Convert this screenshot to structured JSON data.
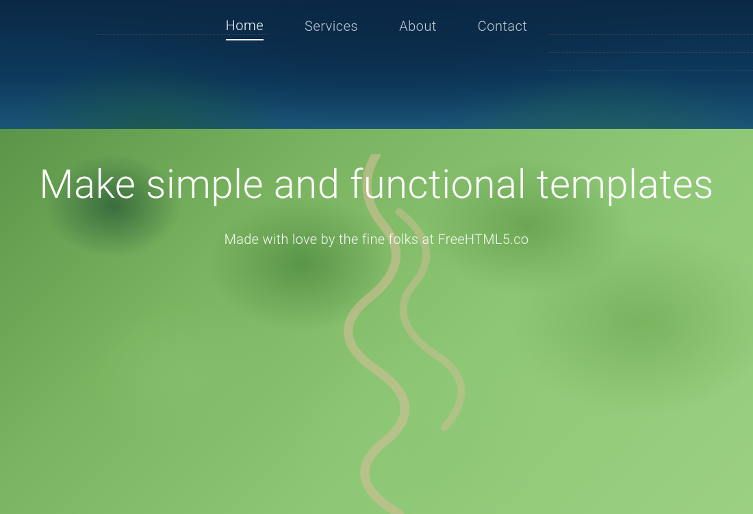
{
  "nav": {
    "items": [
      {
        "label": "Home",
        "active": true
      },
      {
        "label": "Services",
        "active": false
      },
      {
        "label": "About",
        "active": false
      },
      {
        "label": "Contact",
        "active": false
      }
    ]
  },
  "hero": {
    "title": "Make simple and functional templates",
    "subtitle": "Made with love by the fine folks at FreeHTML5.co"
  }
}
